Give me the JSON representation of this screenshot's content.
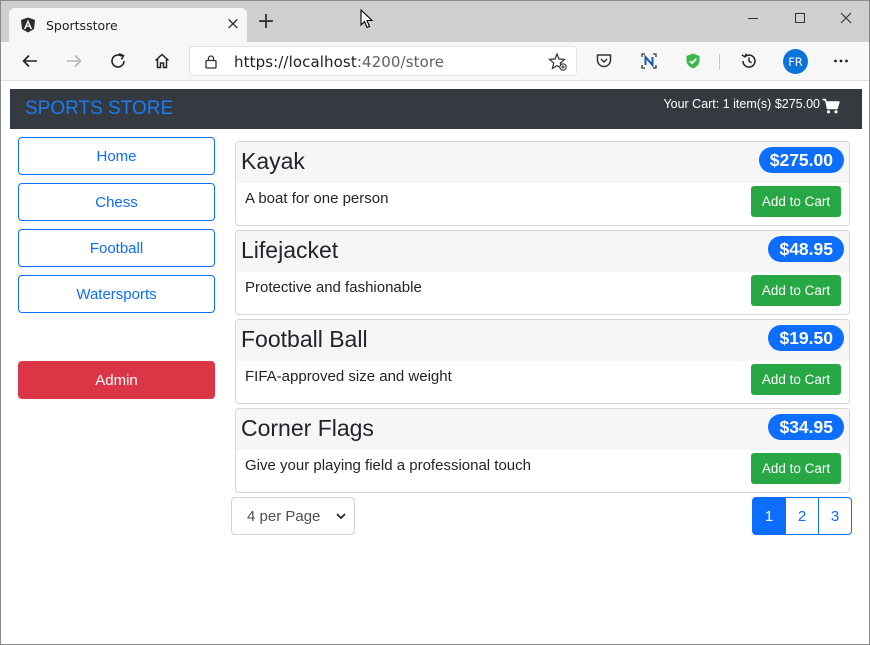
{
  "browser": {
    "tab_title": "Sportsstore",
    "tab_icon": "angular-icon",
    "url_scheme": "https://",
    "url_host": "localhost",
    "url_path": ":4200/store",
    "profile_initials": "FR"
  },
  "navbar": {
    "brand": "SPORTS STORE",
    "cart_summary": "Your Cart: 1 item(s) $275.00"
  },
  "sidebar": {
    "categories": [
      {
        "label": "Home"
      },
      {
        "label": "Chess"
      },
      {
        "label": "Football"
      },
      {
        "label": "Watersports"
      }
    ],
    "admin_label": "Admin"
  },
  "products": [
    {
      "name": "Kayak",
      "price": "$275.00",
      "description": "A boat for one person",
      "button": "Add to Cart"
    },
    {
      "name": "Lifejacket",
      "price": "$48.95",
      "description": "Protective and fashionable",
      "button": "Add to Cart"
    },
    {
      "name": "Football Ball",
      "price": "$19.50",
      "description": "FIFA-approved size and weight",
      "button": "Add to Cart"
    },
    {
      "name": "Corner Flags",
      "price": "$34.95",
      "description": "Give your playing field a professional touch",
      "button": "Add to Cart"
    }
  ],
  "pagination": {
    "per_page_selected": "4 per Page",
    "pages": [
      "1",
      "2",
      "3"
    ],
    "current_page": "1"
  },
  "colors": {
    "navbar_bg": "#343a40",
    "primary": "#0d6efd",
    "success": "#28a745",
    "danger": "#dc3545"
  }
}
